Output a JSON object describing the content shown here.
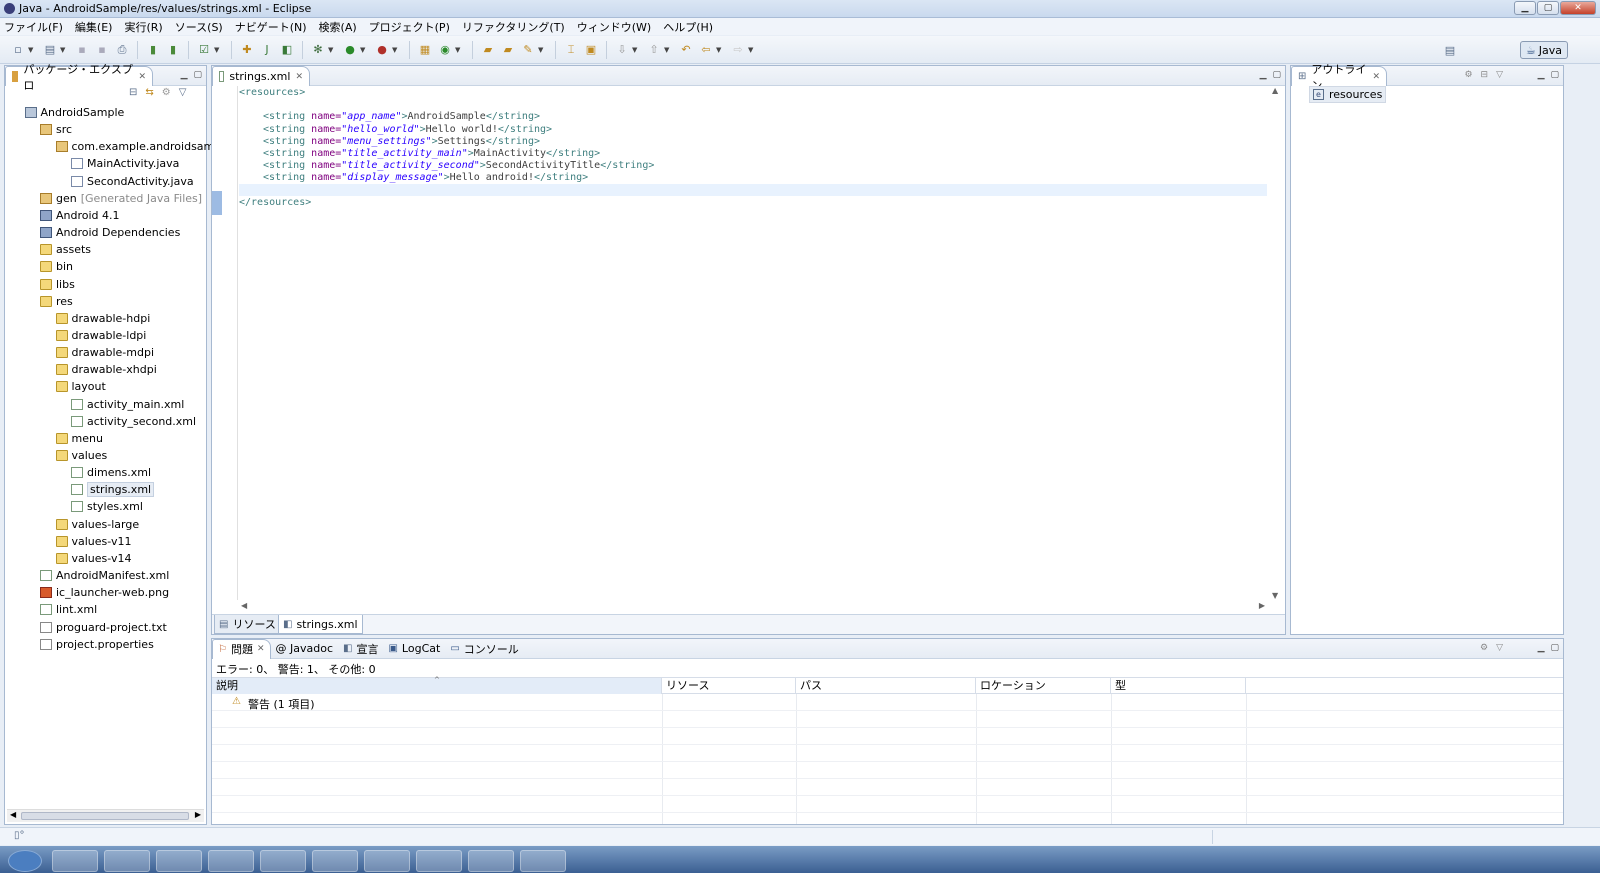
{
  "window": {
    "title": "Java - AndroidSample/res/values/strings.xml - Eclipse"
  },
  "menu": [
    "ファイル(F)",
    "編集(E)",
    "実行(R)",
    "ソース(S)",
    "ナビゲート(N)",
    "検索(A)",
    "プロジェクト(P)",
    "リファクタリング(T)",
    "ウィンドウ(W)",
    "ヘルプ(H)"
  ],
  "perspective": {
    "label": "Java"
  },
  "package_explorer": {
    "tab": "パッケージ・エクスプロ",
    "tree": [
      {
        "label": "AndroidSample",
        "icon": "project-icon"
      },
      {
        "label": "src",
        "icon": "source-folder-icon"
      },
      {
        "label": "com.example.androidsample",
        "icon": "package-icon"
      },
      {
        "label": "MainActivity.java",
        "icon": "java-file-icon"
      },
      {
        "label": "SecondActivity.java",
        "icon": "java-file-icon"
      },
      {
        "label": "gen",
        "suffix": "[Generated Java Files]",
        "icon": "source-folder-icon"
      },
      {
        "label": "Android 4.1",
        "icon": "library-icon"
      },
      {
        "label": "Android Dependencies",
        "icon": "library-icon"
      },
      {
        "label": "assets",
        "icon": "folder-icon"
      },
      {
        "label": "bin",
        "icon": "folder-icon"
      },
      {
        "label": "libs",
        "icon": "folder-icon"
      },
      {
        "label": "res",
        "icon": "folder-icon"
      },
      {
        "label": "drawable-hdpi",
        "icon": "folder-icon"
      },
      {
        "label": "drawable-ldpi",
        "icon": "folder-icon"
      },
      {
        "label": "drawable-mdpi",
        "icon": "folder-icon"
      },
      {
        "label": "drawable-xhdpi",
        "icon": "folder-icon"
      },
      {
        "label": "layout",
        "icon": "folder-icon"
      },
      {
        "label": "activity_main.xml",
        "icon": "xml-file-icon"
      },
      {
        "label": "activity_second.xml",
        "icon": "xml-file-icon"
      },
      {
        "label": "menu",
        "icon": "folder-icon"
      },
      {
        "label": "values",
        "icon": "folder-icon"
      },
      {
        "label": "dimens.xml",
        "icon": "xml-file-icon"
      },
      {
        "label": "strings.xml",
        "icon": "xml-file-icon",
        "selected": true
      },
      {
        "label": "styles.xml",
        "icon": "xml-file-icon"
      },
      {
        "label": "values-large",
        "icon": "folder-icon"
      },
      {
        "label": "values-v11",
        "icon": "folder-icon"
      },
      {
        "label": "values-v14",
        "icon": "folder-icon"
      },
      {
        "label": "AndroidManifest.xml",
        "icon": "xml-file-icon"
      },
      {
        "label": "ic_launcher-web.png",
        "icon": "image-file-icon"
      },
      {
        "label": "lint.xml",
        "icon": "xml-file-icon"
      },
      {
        "label": "proguard-project.txt",
        "icon": "text-file-icon"
      },
      {
        "label": "project.properties",
        "icon": "text-file-icon"
      }
    ]
  },
  "editor": {
    "tab": "strings.xml",
    "lines": [
      {
        "open": "<resources>"
      },
      {
        "blank": true
      },
      {
        "name": "app_name",
        "value": "AndroidSample"
      },
      {
        "name": "hello_world",
        "value": "Hello world!"
      },
      {
        "name": "menu_settings",
        "value": "Settings"
      },
      {
        "name": "title_activity_main",
        "value": "MainActivity"
      },
      {
        "name": "title_activity_second",
        "value": "SecondActivityTitle"
      },
      {
        "name": "display_message",
        "value": "Hello android!"
      },
      {
        "blank": true
      },
      {
        "close": "</resources>"
      }
    ],
    "tag_open": "<string",
    "tag_close": "</string>",
    "attr": " name=",
    "bottom_tabs": [
      "リソース",
      "strings.xml"
    ]
  },
  "outline": {
    "tab": "アウトライン",
    "items": [
      "resources"
    ]
  },
  "problems": {
    "tabs": [
      "問題",
      "@ Javadoc",
      "宣言",
      "LogCat",
      "コンソール"
    ],
    "summary": "エラー: 0、 警告: 1、 その他: 0",
    "columns": [
      "説明",
      "リソース",
      "パス",
      "ロケーション",
      "型"
    ],
    "rows": [
      {
        "description": "警告 (1 項目)"
      }
    ]
  }
}
